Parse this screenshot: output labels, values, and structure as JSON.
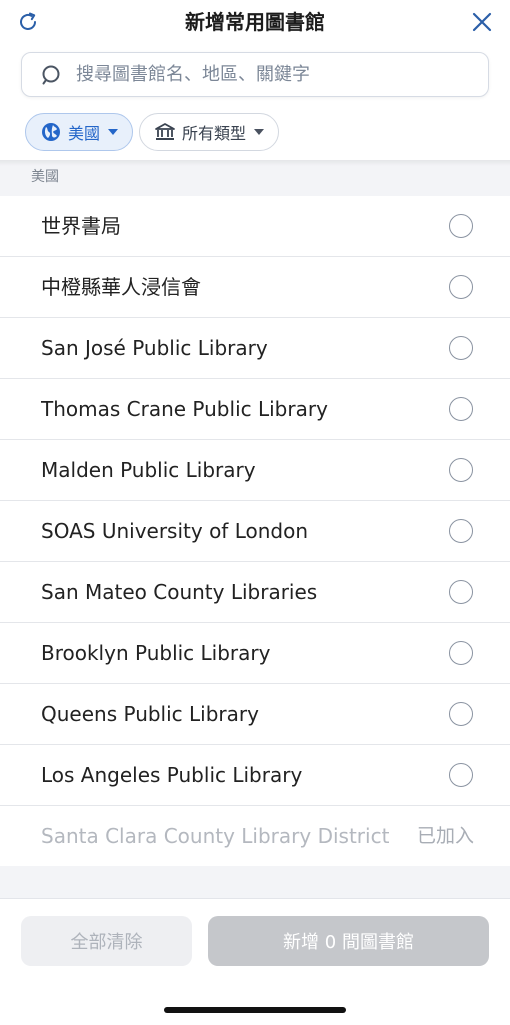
{
  "header": {
    "title": "新增常用圖書館"
  },
  "search": {
    "placeholder": "搜尋圖書館名、地區、關鍵字"
  },
  "filters": {
    "country_label": "美國",
    "type_label": "所有類型"
  },
  "section": {
    "label": "美國"
  },
  "libraries": [
    {
      "name": "世界書局"
    },
    {
      "name": "中橙縣華人浸信會"
    },
    {
      "name": "San José Public Library"
    },
    {
      "name": "Thomas Crane Public Library"
    },
    {
      "name": "Malden Public Library"
    },
    {
      "name": "SOAS University of London"
    },
    {
      "name": "San Mateo County Libraries"
    },
    {
      "name": "Brooklyn Public Library"
    },
    {
      "name": "Queens Public Library"
    },
    {
      "name": "Los Angeles Public Library"
    }
  ],
  "added_library": {
    "name": "Santa Clara County Library District",
    "badge": "已加入"
  },
  "footer": {
    "clear_label": "全部清除",
    "add_label": "新增 0 間圖書館"
  },
  "colors": {
    "accent": "#2466c9",
    "disabled_button": "#c5c7cb"
  },
  "icons": {
    "refresh": "refresh-icon",
    "close": "close-icon",
    "search": "search-icon",
    "globe": "globe-icon",
    "library": "library-building-icon"
  }
}
